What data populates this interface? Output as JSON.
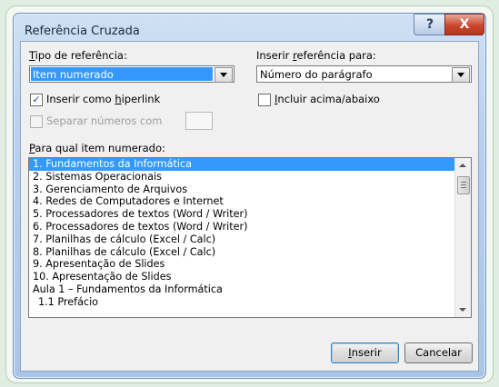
{
  "window": {
    "title": "Referência Cruzada",
    "help_label": "?",
    "close_label": "X"
  },
  "tipo_referencia": {
    "label_prefix": "T",
    "label_rest": "ipo de referência:",
    "value": "Item numerado"
  },
  "inserir_referencia": {
    "label_pre": "Inserir ",
    "label_ul": "r",
    "label_rest": "eferência para:",
    "value": "Número do parágrafo"
  },
  "hiperlink": {
    "checked": true,
    "check_glyph": "✓",
    "label_pre": "Inserir como ",
    "label_ul": "h",
    "label_rest": "iperlink"
  },
  "incluir": {
    "checked": false,
    "label_ul": "I",
    "label_rest": "ncluir acima/abaixo"
  },
  "separar": {
    "label": "Separar números com"
  },
  "list": {
    "label_ul": "P",
    "label_rest": "ara qual item numerado:",
    "items": [
      "1. Fundamentos da Informática",
      "2. Sistemas Operacionais",
      "3. Gerenciamento de Arquivos",
      "4. Redes de Computadores e Internet",
      "5. Processadores de textos (Word / Writer)",
      "6. Processadores de textos (Word / Writer)",
      "7. Planilhas de cálculo (Excel / Calc)",
      "8. Planilhas de cálculo (Excel / Calc)",
      "9. Apresentação de Slides",
      "10. Apresentação de Slides",
      "Aula 1 – Fundamentos da Informática",
      "1.1 Prefácio"
    ],
    "selected_index": 0
  },
  "buttons": {
    "inserir_ul": "I",
    "inserir_rest": "nserir",
    "cancelar": "Cancelar"
  }
}
